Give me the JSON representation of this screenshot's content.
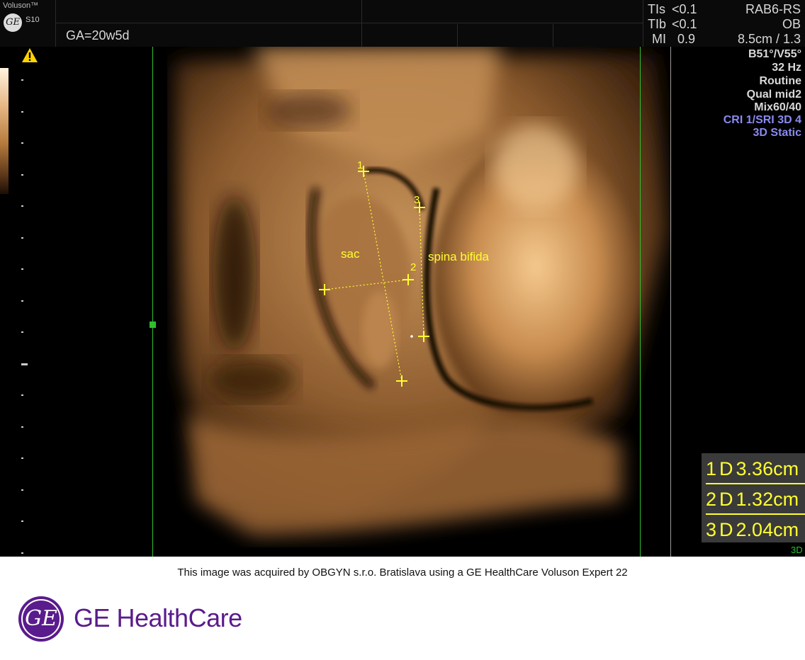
{
  "header": {
    "brand": "Voluson™",
    "model": "S10",
    "logo_letters": "GE",
    "ga": "GA=20w5d",
    "tis_label": "TIs",
    "tis_value": "<0.1",
    "tib_label": "TIb",
    "tib_value": "<0.1",
    "mi_label": "MI",
    "mi_value": "0.9",
    "probe": "RAB6-RS",
    "preset": "OB",
    "depth": "8.5cm / 1.3"
  },
  "info_panel": {
    "angle": "B51°/V55°",
    "frame_rate": "32 Hz",
    "mode": "Routine",
    "quality": "Qual mid2",
    "mix": "Mix60/40",
    "cri": "CRI 1/SRI 3D 4",
    "static": "3D Static"
  },
  "annotations": {
    "sac": "sac",
    "spina": "spina bifida"
  },
  "calipers": {
    "c1": "1",
    "c2": "2",
    "c3": "3"
  },
  "measurements": [
    {
      "index": "1",
      "type": "D",
      "value": "3.36cm"
    },
    {
      "index": "2",
      "type": "D",
      "value": "1.32cm"
    },
    {
      "index": "3",
      "type": "D",
      "value": "2.04cm"
    }
  ],
  "mode_label": "3D",
  "footer": {
    "caption": "This image was acquired by OBGYN s.r.o. Bratislava using a GE HealthCare Voluson Expert 22",
    "company": "GE HealthCare",
    "logo_letters": "GE"
  },
  "colors": {
    "caliper": "#ffff30",
    "guide_line": "#2ec02e",
    "info_blue": "#8a8af0",
    "ge_purple": "#5a1b8c"
  }
}
